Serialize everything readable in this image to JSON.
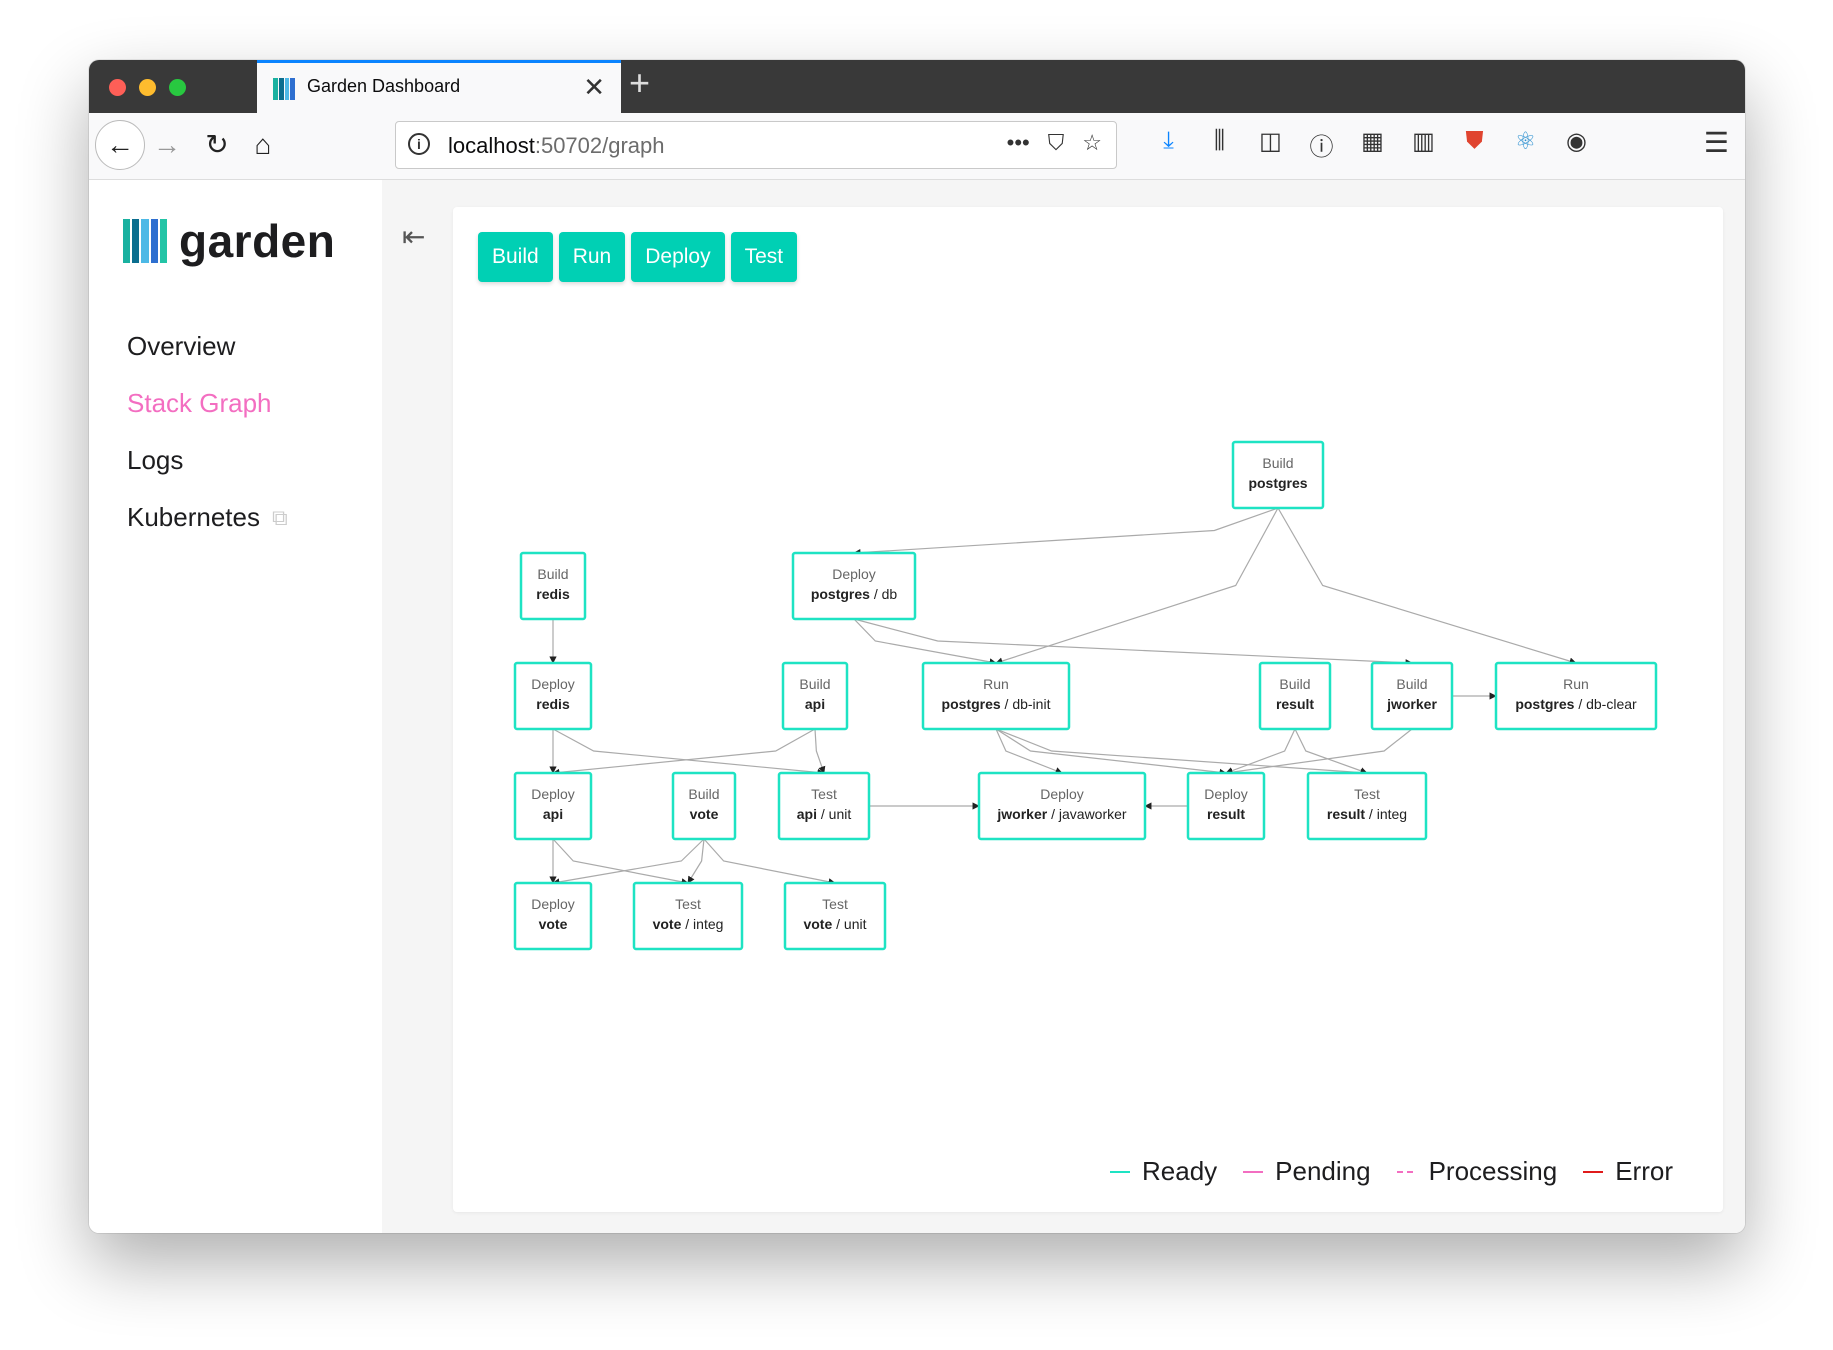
{
  "browser": {
    "tab_title": "Garden Dashboard",
    "url_host": "localhost",
    "url_path": ":50702/graph",
    "icons": [
      "back-icon",
      "forward-icon",
      "reload-icon",
      "home-icon",
      "info-icon",
      "more-icon",
      "pocket-icon",
      "star-icon",
      "download-icon",
      "library-icon",
      "sidebar-icon",
      "password-icon",
      "extensions-icon",
      "grid-icon",
      "shield-icon",
      "react-icon",
      "account-icon",
      "menu-icon"
    ]
  },
  "sidebar": {
    "logo_text": "garden",
    "items": [
      {
        "label": "Overview"
      },
      {
        "label": "Stack Graph"
      },
      {
        "label": "Logs"
      },
      {
        "label": "Kubernetes"
      }
    ]
  },
  "filters": [
    "Build",
    "Run",
    "Deploy",
    "Test"
  ],
  "graph": {
    "nodes": [
      {
        "id": "b-postgres",
        "type": "Build",
        "name": "postgres",
        "sub": ""
      },
      {
        "id": "b-redis",
        "type": "Build",
        "name": "redis",
        "sub": ""
      },
      {
        "id": "d-postgres",
        "type": "Deploy",
        "name": "postgres",
        "sub": " / db"
      },
      {
        "id": "d-redis",
        "type": "Deploy",
        "name": "redis",
        "sub": ""
      },
      {
        "id": "b-api",
        "type": "Build",
        "name": "api",
        "sub": ""
      },
      {
        "id": "r-dbinit",
        "type": "Run",
        "name": "postgres",
        "sub": " / db-init"
      },
      {
        "id": "b-result",
        "type": "Build",
        "name": "result",
        "sub": ""
      },
      {
        "id": "b-jworker",
        "type": "Build",
        "name": "jworker",
        "sub": ""
      },
      {
        "id": "r-dbclear",
        "type": "Run",
        "name": "postgres",
        "sub": " / db-clear"
      },
      {
        "id": "d-api",
        "type": "Deploy",
        "name": "api",
        "sub": ""
      },
      {
        "id": "b-vote",
        "type": "Build",
        "name": "vote",
        "sub": ""
      },
      {
        "id": "t-apiunit",
        "type": "Test",
        "name": "api",
        "sub": " / unit"
      },
      {
        "id": "d-jworker",
        "type": "Deploy",
        "name": "jworker",
        "sub": " / javaworker"
      },
      {
        "id": "d-result",
        "type": "Deploy",
        "name": "result",
        "sub": ""
      },
      {
        "id": "t-resultinteg",
        "type": "Test",
        "name": "result",
        "sub": " / integ"
      },
      {
        "id": "d-vote",
        "type": "Deploy",
        "name": "vote",
        "sub": ""
      },
      {
        "id": "t-voteinteg",
        "type": "Test",
        "name": "vote",
        "sub": " / integ"
      },
      {
        "id": "t-voteunit",
        "type": "Test",
        "name": "vote",
        "sub": " / unit"
      }
    ],
    "edges": [
      [
        "b-postgres",
        "d-postgres"
      ],
      [
        "b-postgres",
        "r-dbinit"
      ],
      [
        "b-postgres",
        "r-dbclear"
      ],
      [
        "b-redis",
        "d-redis"
      ],
      [
        "d-postgres",
        "r-dbinit"
      ],
      [
        "d-postgres",
        "b-jworker"
      ],
      [
        "d-redis",
        "d-api"
      ],
      [
        "d-redis",
        "t-apiunit"
      ],
      [
        "b-api",
        "d-api"
      ],
      [
        "b-api",
        "t-apiunit"
      ],
      [
        "r-dbinit",
        "d-jworker"
      ],
      [
        "r-dbinit",
        "d-result"
      ],
      [
        "r-dbinit",
        "t-resultinteg"
      ],
      [
        "b-result",
        "d-result"
      ],
      [
        "b-result",
        "t-resultinteg"
      ],
      [
        "b-jworker",
        "d-result"
      ],
      [
        "b-jworker",
        "r-dbclear"
      ],
      [
        "d-result",
        "d-jworker"
      ],
      [
        "t-apiunit",
        "d-jworker"
      ],
      [
        "d-api",
        "d-vote"
      ],
      [
        "d-api",
        "t-voteinteg"
      ],
      [
        "b-vote",
        "d-vote"
      ],
      [
        "b-vote",
        "t-voteinteg"
      ],
      [
        "b-vote",
        "t-voteunit"
      ]
    ]
  },
  "legend": [
    {
      "label": "Ready",
      "color": "#1ee3c3",
      "dash": false
    },
    {
      "label": "Pending",
      "color": "#f36ec1",
      "dash": false
    },
    {
      "label": "Processing",
      "color": "#f36ec1",
      "dash": true
    },
    {
      "label": "Error",
      "color": "#e01b1b",
      "dash": false
    }
  ],
  "colors": {
    "accent": "#00d0b4",
    "node_border": "#1ee3c3",
    "active_nav": "#f36ec1"
  }
}
